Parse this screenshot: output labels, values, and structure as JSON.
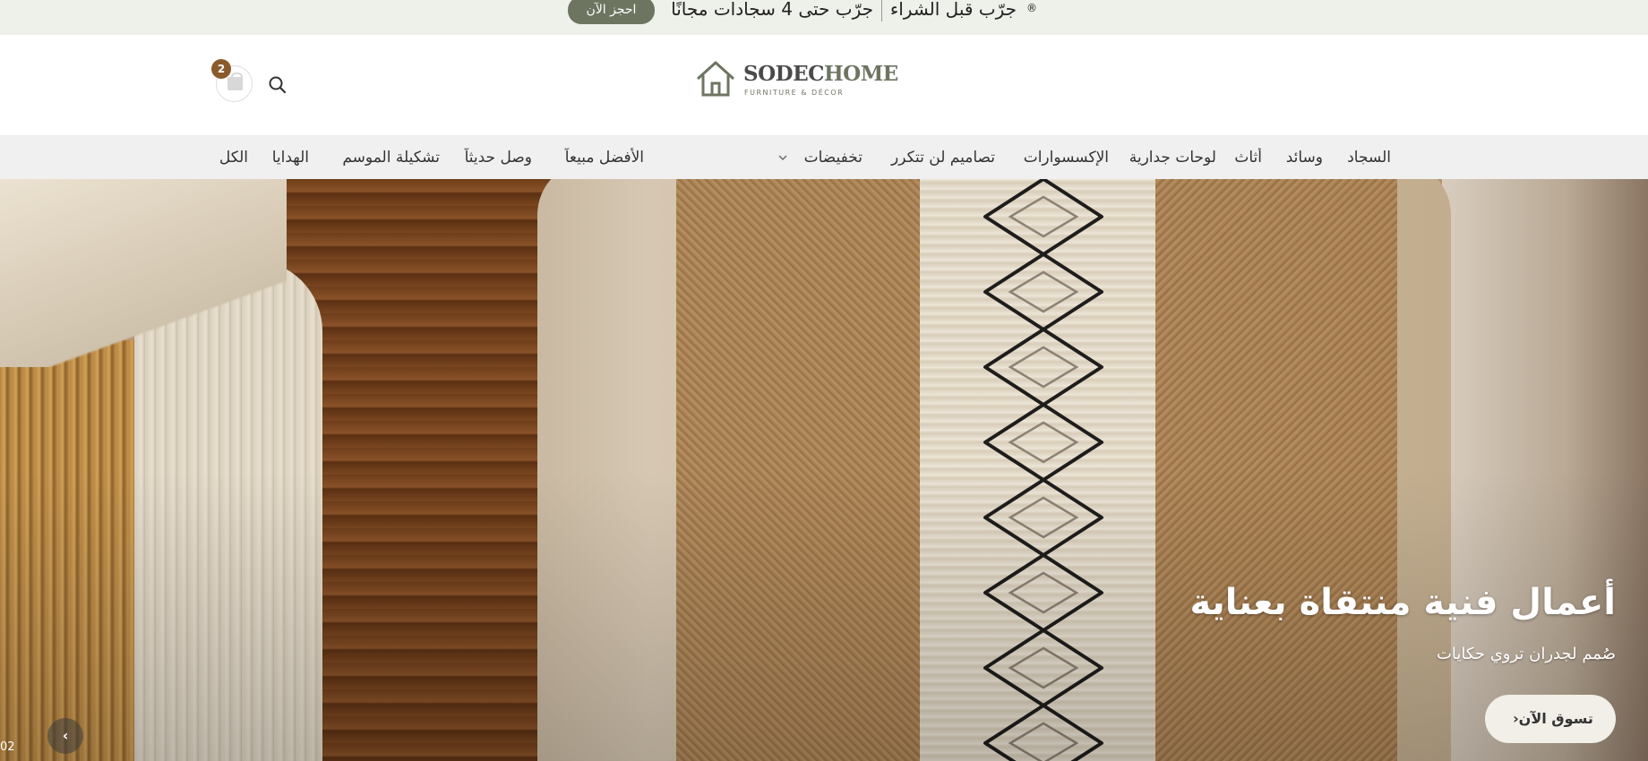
{
  "announcement": {
    "book_button": "احجز الآن",
    "message1": "جرّب حتى 4 سجادات مجانًا",
    "message2": "جرّب قبل الشراء",
    "registered_mark": "®"
  },
  "header": {
    "cart_count": "2",
    "logo": {
      "brand_part1": "SODEC",
      "brand_part2": "HOME",
      "tagline": "FURNITURE & DÉCOR"
    }
  },
  "nav": {
    "right_items": [
      "السجاد",
      "وسائد",
      "أثاث",
      "لوحات جدارية",
      "الإكسسوارات",
      "تصاميم لن تتكرر",
      "تخفيضات"
    ],
    "left_items": [
      "الأفضل مبيعاً",
      "وصل حديثاً",
      "تشكيلة الموسم",
      "الهدايا",
      "الكل"
    ]
  },
  "hero": {
    "title": "أعمال فنية منتقاة بعناية",
    "subtitle": "صُمم لجدران تروي حكايات",
    "button": "تسوق الآن",
    "slide_number": "02",
    "prev_arrow": "‹"
  },
  "colors": {
    "accent_olive": "#6d7561",
    "cart_badge": "#8a5a2b",
    "announcement_bg": "#eef0ea",
    "nav_bg": "#f0f0f0"
  },
  "icons": [
    "cart-icon",
    "search-icon",
    "house-logo-icon",
    "chevron-down-icon",
    "chevron-left-icon"
  ]
}
